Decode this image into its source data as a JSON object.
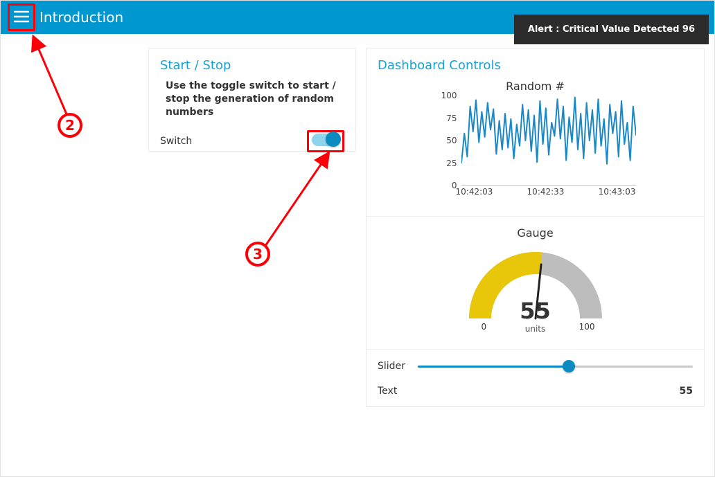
{
  "header": {
    "title": "Introduction",
    "alert_text": "Alert : Critical Value Detected 96"
  },
  "left_card": {
    "title": "Start / Stop",
    "instruction": "Use the toggle switch to start / stop the generation of random numbers",
    "switch_label": "Switch",
    "switch_on": true
  },
  "right_card": {
    "title": "Dashboard Controls",
    "chart_title": "Random #",
    "gauge_title": "Gauge",
    "gauge_value": "55",
    "gauge_units": "units",
    "gauge_min": "0",
    "gauge_max": "100",
    "slider_label": "Slider",
    "slider_value": 55,
    "slider_min": 0,
    "slider_max": 100,
    "text_label": "Text",
    "text_value": "55"
  },
  "annotations": {
    "callout2": "2",
    "callout3": "3"
  },
  "chart_data": {
    "type": "line",
    "title": "Random #",
    "xlabel": "",
    "ylabel": "",
    "ylim": [
      0,
      100
    ],
    "y_ticks": [
      0,
      25,
      50,
      75,
      100
    ],
    "x_ticks": [
      "10:42:03",
      "10:42:33",
      "10:43:03"
    ],
    "x": [
      0,
      1,
      2,
      3,
      4,
      5,
      6,
      7,
      8,
      9,
      10,
      11,
      12,
      13,
      14,
      15,
      16,
      17,
      18,
      19,
      20,
      21,
      22,
      23,
      24,
      25,
      26,
      27,
      28,
      29,
      30,
      31,
      32,
      33,
      34,
      35,
      36,
      37,
      38,
      39,
      40,
      41,
      42,
      43,
      44,
      45,
      46,
      47,
      48,
      49,
      50,
      51,
      52,
      53,
      54,
      55,
      56,
      57,
      58,
      59,
      60
    ],
    "values": [
      25,
      58,
      32,
      88,
      60,
      95,
      48,
      82,
      54,
      92,
      62,
      85,
      35,
      72,
      40,
      80,
      42,
      74,
      30,
      68,
      44,
      90,
      50,
      84,
      38,
      78,
      26,
      94,
      46,
      86,
      34,
      70,
      55,
      96,
      52,
      88,
      28,
      76,
      48,
      98,
      40,
      80,
      30,
      92,
      50,
      84,
      36,
      96,
      44,
      74,
      24,
      90,
      58,
      82,
      32,
      94,
      46,
      70,
      28,
      88,
      56
    ]
  }
}
